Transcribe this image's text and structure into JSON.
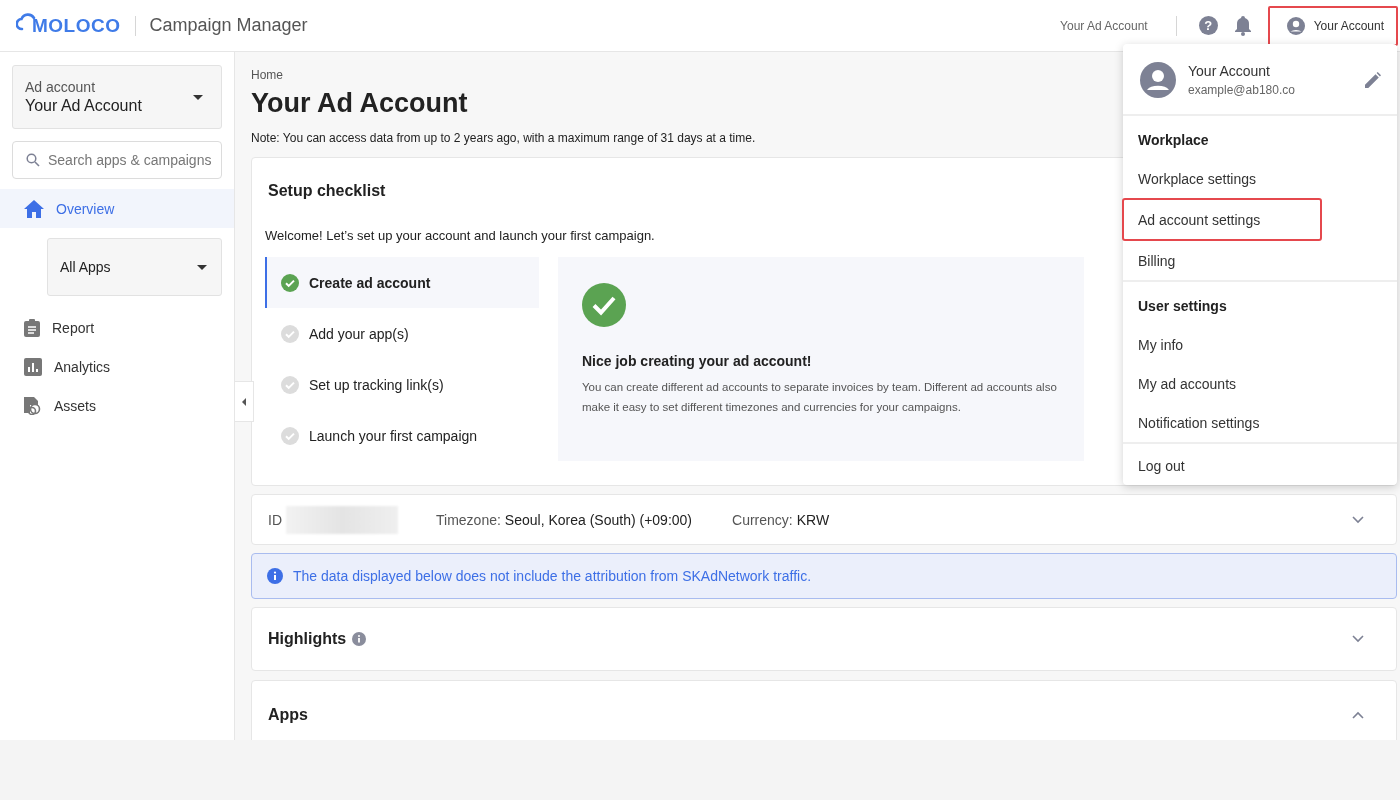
{
  "header": {
    "logo": "MOLOCO",
    "app_title": "Campaign Manager",
    "account_name": "Your Ad Account",
    "help": "?",
    "account_button": {
      "label": "Your Account",
      "highlighted": true
    }
  },
  "sidebar": {
    "ad_account": {
      "label": "Ad account",
      "value": "Your Ad Account"
    },
    "search": {
      "placeholder": "Search apps & campaigns"
    },
    "items": [
      {
        "label": "Overview",
        "selected": true
      },
      {
        "label": "Report",
        "selected": false
      },
      {
        "label": "Analytics",
        "selected": false
      },
      {
        "label": "Assets",
        "selected": false
      }
    ],
    "apps_filter": "All Apps"
  },
  "main": {
    "breadcrumb": "Home",
    "title": "Your Ad Account",
    "note": "Note: You can access data from up to 2 years ago, with a maximum range of 31 days at a time.",
    "setup_checklist": {
      "title": "Setup checklist",
      "welcome": "Welcome! Let’s set up your account and launch your first campaign.",
      "steps": [
        {
          "label": "Create ad account",
          "done": true,
          "selected": true
        },
        {
          "label": "Add your app(s)",
          "done": false,
          "selected": false
        },
        {
          "label": "Set up tracking link(s)",
          "done": false,
          "selected": false
        },
        {
          "label": "Launch your first campaign",
          "done": false,
          "selected": false
        }
      ],
      "detail": {
        "title": "Nice job creating your ad account!",
        "text": "You can create different ad accounts to separate invoices by team. Different ad accounts also make it easy to set different timezones and currencies for your campaigns."
      }
    },
    "account_info": {
      "id_label": "ID",
      "timezone_label": "Timezone:",
      "timezone": "Seoul, Korea (South) (+09:00)",
      "currency_label": "Currency:",
      "currency": "KRW",
      "expanded": false
    },
    "notice": "The data displayed below does not include the attribution from SKAdNetwork traffic.",
    "sections": [
      {
        "title": "Highlights",
        "info": true,
        "expanded": false
      },
      {
        "title": "Apps",
        "info": false,
        "expanded": true
      }
    ]
  },
  "account_menu": {
    "name": "Your Account",
    "email": "example@ab180.co",
    "groups": [
      {
        "heading": "Workplace",
        "items": [
          {
            "label": "Workplace settings",
            "highlighted": false
          },
          {
            "label": "Ad account settings",
            "highlighted": true
          },
          {
            "label": "Billing",
            "highlighted": false
          }
        ]
      },
      {
        "heading": "User settings",
        "items": [
          {
            "label": "My info",
            "highlighted": false
          },
          {
            "label": "My ad accounts",
            "highlighted": false
          },
          {
            "label": "Notification settings",
            "highlighted": false
          }
        ]
      }
    ],
    "logout": "Log out"
  }
}
